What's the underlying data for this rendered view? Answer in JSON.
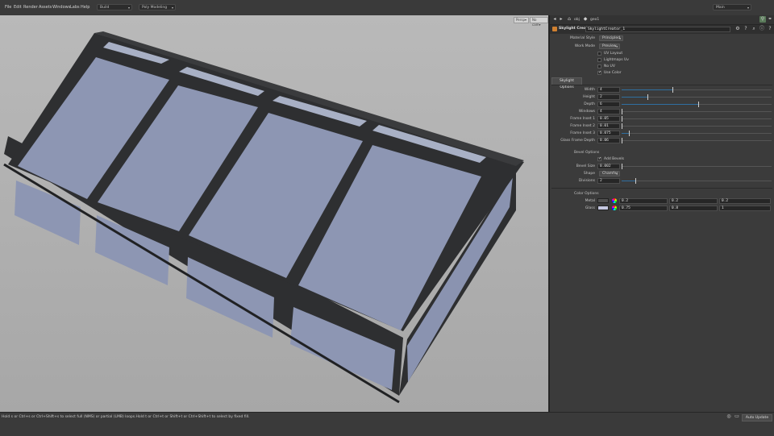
{
  "menu": [
    "File",
    "Edit",
    "Render",
    "Assets",
    "Windows",
    "Labs",
    "Help"
  ],
  "toolbar": {
    "desktop": "Build",
    "shelf": "Poly Modeling"
  },
  "top_right": {
    "channel": "Main"
  },
  "viewport": {
    "camera_label": "Persp▾",
    "display_label": "No cam▾"
  },
  "path": {
    "context": "obj",
    "node": "geo1"
  },
  "node": {
    "type": "Skylight Creator",
    "name": "SkylightCreator_1"
  },
  "params": {
    "material_style": {
      "label": "Material Style",
      "value": "Principled"
    },
    "work_mode": {
      "label": "Work Mode",
      "value": "Preview"
    },
    "toggles": [
      {
        "label": "UV Layout",
        "checked": false
      },
      {
        "label": "Lightmaps Uv",
        "checked": false
      },
      {
        "label": "No UV",
        "checked": false
      },
      {
        "label": "Use Color",
        "checked": true
      }
    ],
    "tab": "Skylight Options",
    "rows": [
      {
        "label": "Width",
        "value": "4",
        "frac": 0.34
      },
      {
        "label": "Height",
        "value": "2",
        "frac": 0.17
      },
      {
        "label": "Depth",
        "value": "6",
        "frac": 0.51
      },
      {
        "label": "Windows",
        "value": "4",
        "frac": 0.0
      },
      {
        "label": "Frame Inset 1",
        "value": "0.05",
        "frac": 0.0
      },
      {
        "label": "Frame Inset 2",
        "value": "0.01",
        "frac": 0.0
      },
      {
        "label": "Frame Inset 3",
        "value": "0.075",
        "frac": 0.05
      },
      {
        "label": "Glass Frame Depth",
        "value": "0.06",
        "frac": 0.0
      }
    ],
    "bevel": {
      "section": "Bevel Options",
      "add_label": "Add Bevels",
      "size": {
        "label": "Bevel Size",
        "value": "0.002"
      },
      "shape": {
        "label": "Shape",
        "value": "Chamfer"
      },
      "divisions": {
        "label": "Divisions",
        "value": "2",
        "frac": 0.09
      }
    },
    "color": {
      "section": "Color Options",
      "rows": [
        {
          "label": "Metal",
          "swatch": "#505050",
          "values": [
            "0.2",
            "0.2",
            "0.2"
          ]
        },
        {
          "label": "Glass",
          "swatch": "#c4c7e0",
          "values": [
            "0.75",
            "0.8",
            "1"
          ]
        }
      ]
    }
  },
  "status": {
    "message": "Hold s or Ctrl+s or Ctrl+Shift+s to select full (NMS) or partial (LMB) loops.Hold t or Ctrl+t or Shift+t or Ctrl+Shift+t to select by fixed fill.",
    "update_mode": "Auto Update"
  },
  "colors": {
    "frame": "#2e2f31",
    "glass": "#8d96b3",
    "viewport_bg": "#b2b2b2",
    "accent": "#2f6fa0"
  }
}
